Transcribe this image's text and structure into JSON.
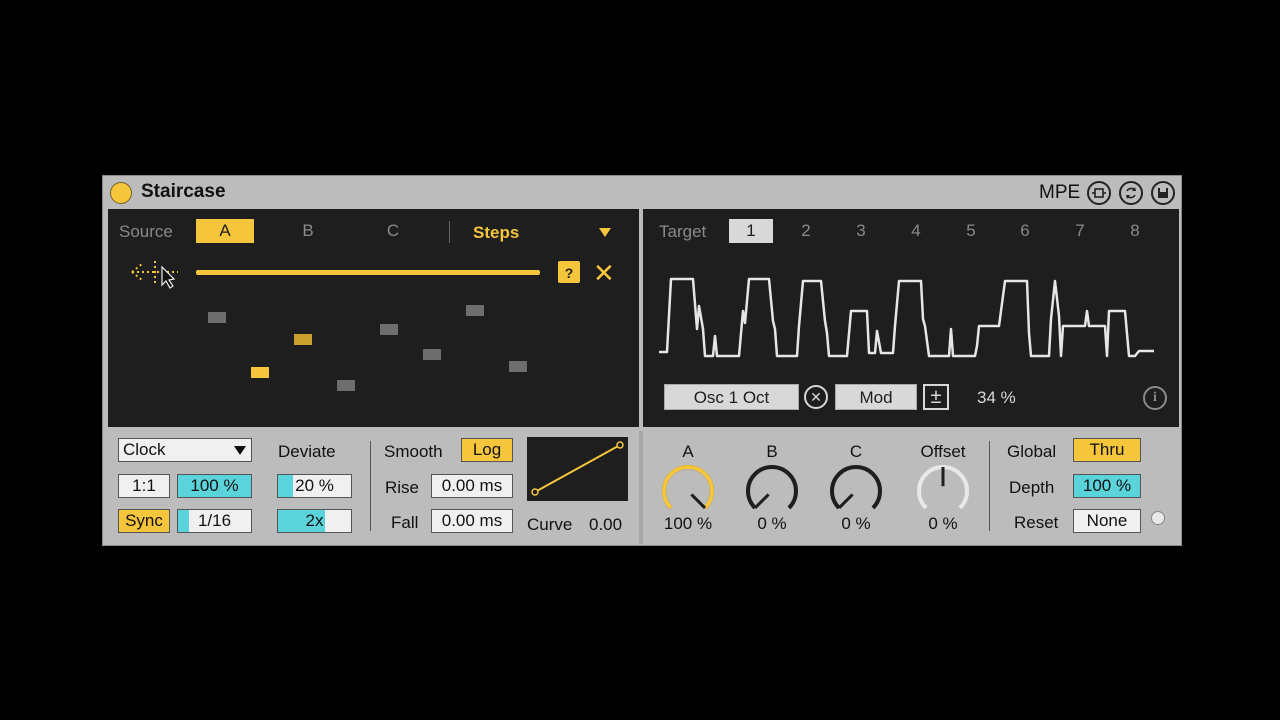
{
  "device": {
    "title": "Staircase",
    "mpe_label": "MPE",
    "icons": [
      "mpe-icon",
      "refresh-icon",
      "save-icon"
    ]
  },
  "source": {
    "label": "Source",
    "tabs": [
      "A",
      "B",
      "C"
    ],
    "active_tab": "A",
    "mode": "Steps",
    "dice_label": "?",
    "step_values": [
      0.8,
      0.28,
      0.59,
      0.16,
      0.69,
      0.45,
      0.87,
      0.34
    ]
  },
  "target": {
    "label": "Target",
    "tabs": [
      "1",
      "2",
      "3",
      "4",
      "5",
      "6",
      "7",
      "8"
    ],
    "active_tab": "1",
    "destination": "Osc 1 Oct",
    "mod_label": "Mod",
    "plus_minus": "±",
    "amount": "34 %",
    "info_label": "i"
  },
  "clock": {
    "mode": "Clock",
    "ratio": "1:1",
    "rate_percent": "100 %",
    "rate_fill": 1.0,
    "sync_label": "Sync",
    "sync_value": "1/16",
    "sync_fill": 0.15
  },
  "deviate": {
    "label": "Deviate",
    "amount": "20 %",
    "amount_fill": 0.2,
    "factor": "2x",
    "factor_fill": 0.65
  },
  "smooth": {
    "label": "Smooth",
    "log_label": "Log",
    "rise_label": "Rise",
    "rise_value": "0.00 ms",
    "fall_label": "Fall",
    "fall_value": "0.00 ms",
    "curve_label": "Curve",
    "curve_value": "0.00"
  },
  "knobs": [
    {
      "label": "A",
      "value": "100 %",
      "level": 1.0
    },
    {
      "label": "B",
      "value": "0 %",
      "level": 0.0
    },
    {
      "label": "C",
      "value": "0 %",
      "level": 0.0
    },
    {
      "label": "Offset",
      "value": "0 %",
      "level": 0.0
    }
  ],
  "global": {
    "label": "Global",
    "thru_label": "Thru",
    "depth_label": "Depth",
    "depth_value": "100 %",
    "reset_label": "Reset",
    "reset_value": "None"
  },
  "colors": {
    "accent": "#f5c53c",
    "cyan": "#5bd3db",
    "panel": "#1e1e1e",
    "body": "#bcbcbc"
  }
}
